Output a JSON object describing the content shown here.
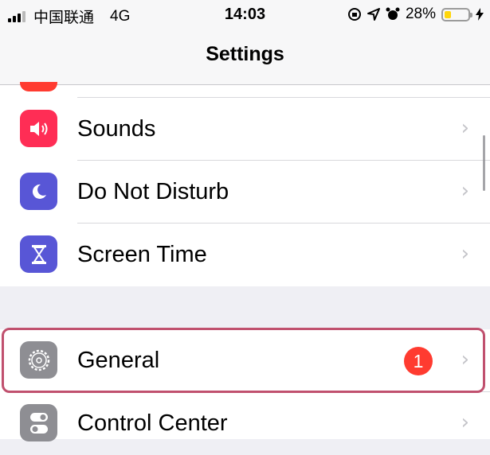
{
  "status": {
    "carrier": "中国联通",
    "network": "4G",
    "time": "14:03",
    "battery": "28%",
    "battery_level": 0.28
  },
  "nav": {
    "title": "Settings"
  },
  "group1": [
    {
      "label": "Sounds",
      "icon": "speaker-icon",
      "color": "#ff2d55"
    },
    {
      "label": "Do Not Disturb",
      "icon": "moon-icon",
      "color": "#5856d6"
    },
    {
      "label": "Screen Time",
      "icon": "hourglass-icon",
      "color": "#5856d6"
    }
  ],
  "group2": [
    {
      "label": "General",
      "icon": "gear-icon",
      "color": "#8e8e93",
      "badge": "1"
    },
    {
      "label": "Control Center",
      "icon": "toggle-icon",
      "color": "#8e8e93"
    }
  ],
  "colors": {
    "highlight": "#c0506e",
    "badge": "#ff3b30",
    "notifications_icon": "#ff3b30"
  }
}
